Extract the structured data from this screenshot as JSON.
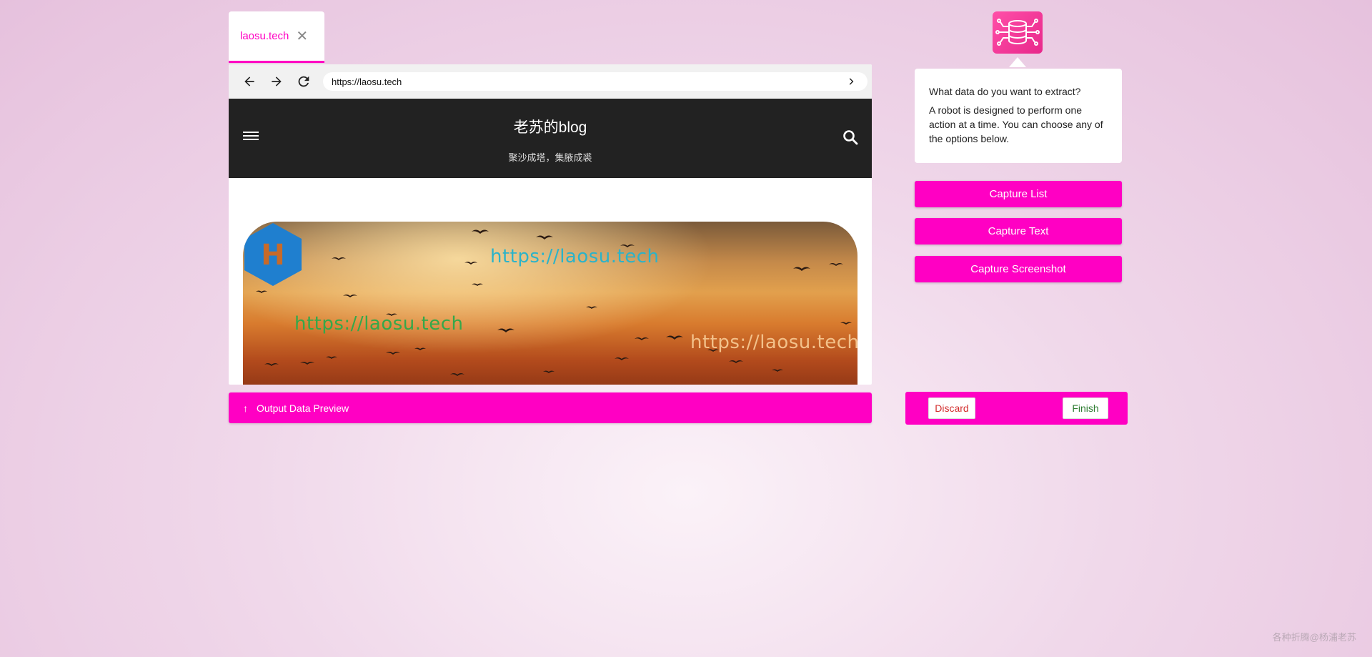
{
  "tab": {
    "title": "laosu.tech",
    "close_icon": "close-icon"
  },
  "browser": {
    "url": "https://laosu.tech",
    "site_title": "老苏的blog",
    "site_subtitle": "聚沙成塔，集腋成裘",
    "banner_watermarks": [
      "https://laosu.tech",
      "https://laosu.tech",
      "https://laosu.tech"
    ],
    "banner_badge": "H"
  },
  "output_bar": {
    "label": "Output Data Preview"
  },
  "panel": {
    "question": "What data do you want to extract?",
    "description": "A robot is designed to perform one action at a time. You can choose any of the options below.",
    "buttons": [
      "Capture List",
      "Capture Text",
      "Capture Screenshot"
    ],
    "discard_label": "Discard",
    "finish_label": "Finish"
  },
  "footer_watermark": "各种折腾@杨浦老苏",
  "colors": {
    "accent": "#ff00c3",
    "header_bg": "#222222",
    "discard": "#d32f2f",
    "finish": "#2e7d32"
  }
}
